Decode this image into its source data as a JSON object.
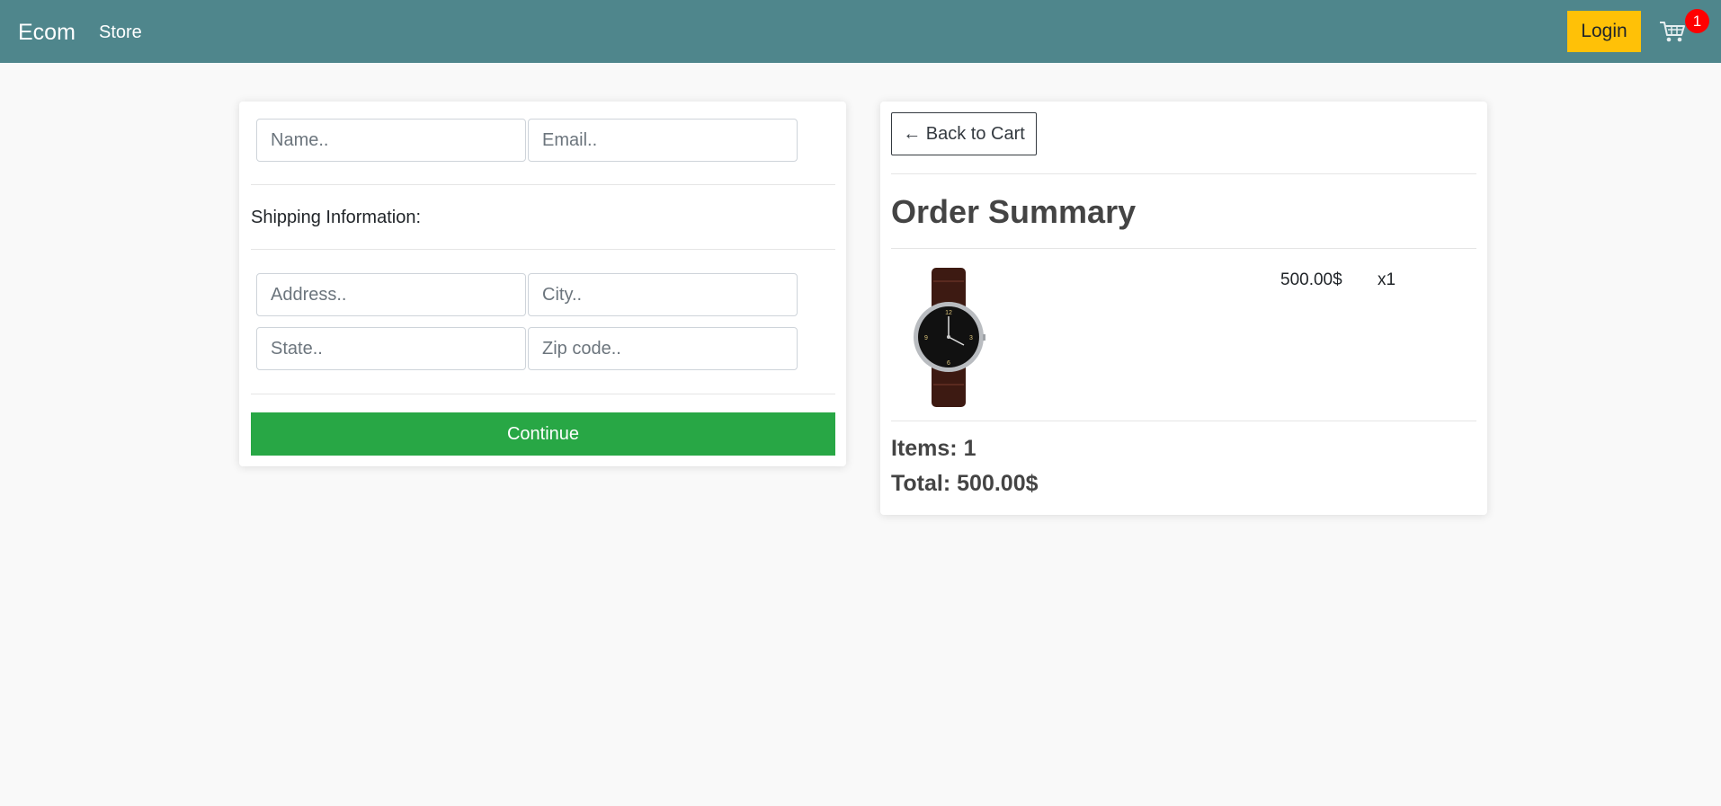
{
  "navbar": {
    "brand": "Ecom",
    "store_link": "Store",
    "login_label": "Login",
    "cart_count": "1",
    "cart_icon": "cart-icon",
    "bg_color": "#4f868c"
  },
  "form": {
    "name_placeholder": "Name..",
    "email_placeholder": "Email..",
    "shipping_label": "Shipping Information:",
    "address_placeholder": "Address..",
    "city_placeholder": "City..",
    "state_placeholder": "State..",
    "zip_placeholder": "Zip code..",
    "continue_label": "Continue"
  },
  "summary": {
    "back_label": "← Back to Cart",
    "title": "Order Summary",
    "items": [
      {
        "image": "watch-image",
        "price": "500.00$",
        "quantity": "x1"
      }
    ],
    "items_count": "Items: 1",
    "total": "Total: 500.00$"
  },
  "colors": {
    "continue": "#28a745",
    "login": "#ffc107",
    "badge": "#ff0000"
  }
}
